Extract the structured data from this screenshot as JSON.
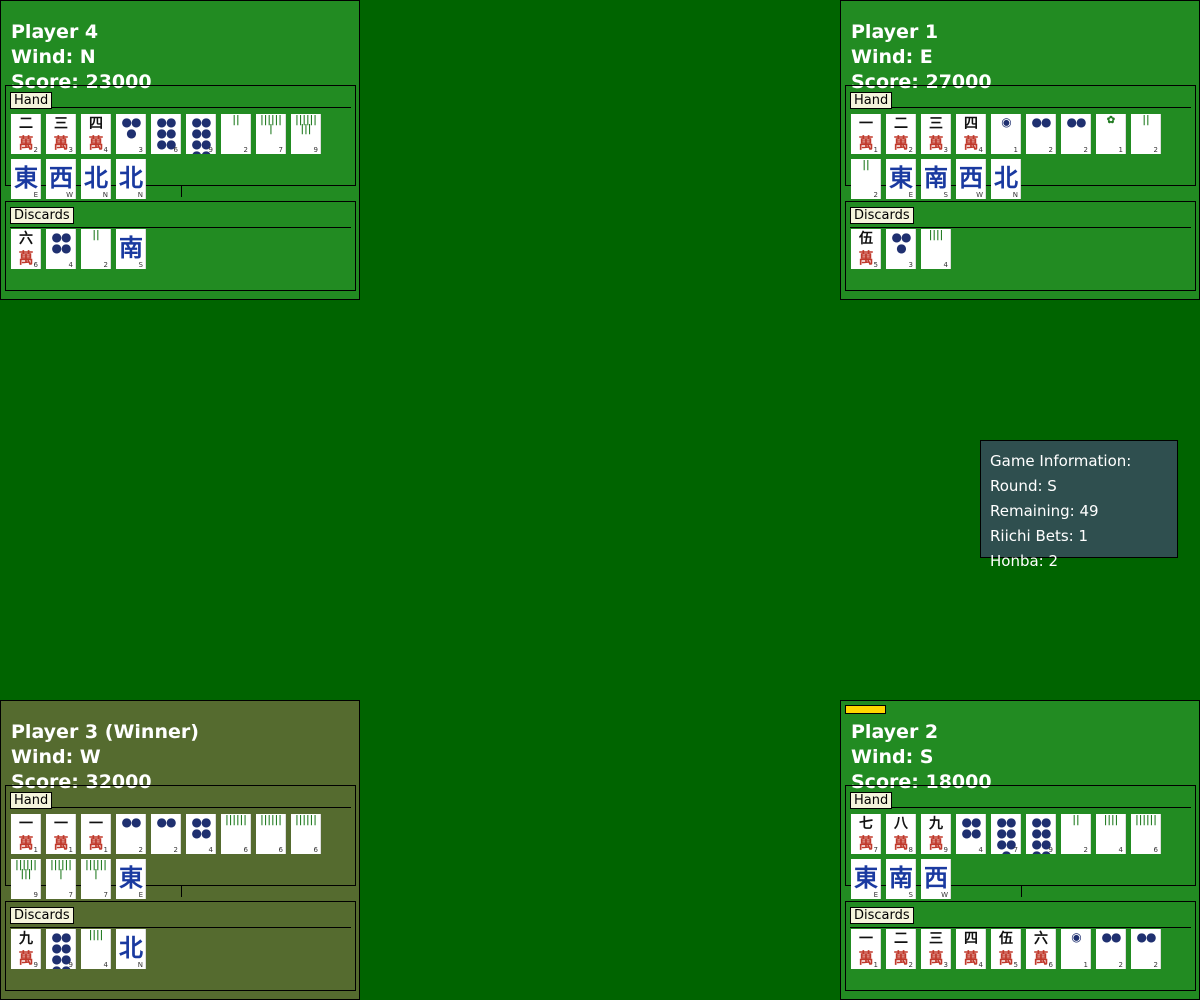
{
  "players": [
    {
      "key": "p4",
      "name": "Player 4",
      "wind": "Wind: N",
      "score": "Score: 23000",
      "winner": false,
      "hand_label": "Hand",
      "discards_label": "Discards",
      "hand": [
        {
          "suit": "man",
          "top": "二",
          "bottom": "萬",
          "corner": "2"
        },
        {
          "suit": "man",
          "top": "三",
          "bottom": "萬",
          "corner": "3"
        },
        {
          "suit": "man",
          "top": "四",
          "bottom": "萬",
          "corner": "4"
        },
        {
          "suit": "pin",
          "top": "●●●",
          "corner": "3"
        },
        {
          "suit": "pin",
          "top": "●●●●●●",
          "corner": "6"
        },
        {
          "suit": "pin",
          "top": "●●●●●●●●●",
          "corner": "9"
        },
        {
          "suit": "sou",
          "top": "||",
          "corner": "2"
        },
        {
          "suit": "sou",
          "top": "|||||||",
          "corner": "7"
        },
        {
          "suit": "sou",
          "top": "|||||||||",
          "corner": "9"
        },
        {
          "suit": "honor",
          "top": "東",
          "corner": "E"
        },
        {
          "suit": "honor",
          "top": "西",
          "corner": "W"
        },
        {
          "suit": "honor",
          "top": "北",
          "corner": "N"
        },
        {
          "suit": "honor",
          "top": "北",
          "corner": "N"
        }
      ],
      "discards": [
        {
          "suit": "man",
          "top": "六",
          "bottom": "萬",
          "corner": "6"
        },
        {
          "suit": "pin",
          "top": "●●●●",
          "corner": "4"
        },
        {
          "suit": "sou",
          "top": "||",
          "corner": "2"
        },
        {
          "suit": "honor",
          "top": "南",
          "corner": "S"
        }
      ]
    },
    {
      "key": "p1",
      "name": "Player 1",
      "wind": "Wind: E",
      "score": "Score: 27000",
      "winner": false,
      "hand_label": "Hand",
      "discards_label": "Discards",
      "hand": [
        {
          "suit": "man",
          "top": "一",
          "bottom": "萬",
          "corner": "1"
        },
        {
          "suit": "man",
          "top": "二",
          "bottom": "萬",
          "corner": "2"
        },
        {
          "suit": "man",
          "top": "三",
          "bottom": "萬",
          "corner": "3"
        },
        {
          "suit": "man",
          "top": "四",
          "bottom": "萬",
          "corner": "4"
        },
        {
          "suit": "pin",
          "top": "◉",
          "corner": "1"
        },
        {
          "suit": "pin",
          "top": "●●",
          "corner": "2"
        },
        {
          "suit": "pin",
          "top": "●●",
          "corner": "2"
        },
        {
          "suit": "sou",
          "top": "✿",
          "corner": "1"
        },
        {
          "suit": "sou",
          "top": "||",
          "corner": "2"
        },
        {
          "suit": "sou",
          "top": "||",
          "corner": "2"
        },
        {
          "suit": "honor",
          "top": "東",
          "corner": "E"
        },
        {
          "suit": "honor",
          "top": "南",
          "corner": "S"
        },
        {
          "suit": "honor",
          "top": "西",
          "corner": "W"
        },
        {
          "suit": "honor",
          "top": "北",
          "corner": "N"
        }
      ],
      "discards": [
        {
          "suit": "man",
          "top": "伍",
          "bottom": "萬",
          "corner": "5"
        },
        {
          "suit": "pin",
          "top": "●●●",
          "corner": "3"
        },
        {
          "suit": "sou",
          "top": "||||",
          "corner": "4"
        }
      ]
    },
    {
      "key": "p3",
      "name": "Player 3 (Winner)",
      "wind": "Wind: W",
      "score": "Score: 32000",
      "winner": true,
      "hand_label": "Hand",
      "discards_label": "Discards",
      "hand": [
        {
          "suit": "man",
          "top": "一",
          "bottom": "萬",
          "corner": "1"
        },
        {
          "suit": "man",
          "top": "一",
          "bottom": "萬",
          "corner": "1"
        },
        {
          "suit": "man",
          "top": "一",
          "bottom": "萬",
          "corner": "1"
        },
        {
          "suit": "pin",
          "top": "●●",
          "corner": "2"
        },
        {
          "suit": "pin",
          "top": "●●",
          "corner": "2"
        },
        {
          "suit": "pin",
          "top": "●●●●",
          "corner": "4"
        },
        {
          "suit": "sou",
          "top": "||||||",
          "corner": "6"
        },
        {
          "suit": "sou",
          "top": "||||||",
          "corner": "6"
        },
        {
          "suit": "sou",
          "top": "||||||",
          "corner": "6"
        },
        {
          "suit": "sou",
          "top": "|||||||||",
          "corner": "9"
        },
        {
          "suit": "sou",
          "top": "|||||||",
          "corner": "7"
        },
        {
          "suit": "sou",
          "top": "|||||||",
          "corner": "7"
        },
        {
          "suit": "honor",
          "top": "東",
          "corner": "E"
        }
      ],
      "discards": [
        {
          "suit": "man",
          "top": "九",
          "bottom": "萬",
          "corner": "9"
        },
        {
          "suit": "pin",
          "top": "●●●●●●●●●",
          "corner": "9"
        },
        {
          "suit": "sou",
          "top": "||||",
          "corner": "4"
        },
        {
          "suit": "honor",
          "top": "北",
          "corner": "N"
        }
      ]
    },
    {
      "key": "p2",
      "name": "Player 2",
      "wind": "Wind: S",
      "score": "Score: 18000",
      "winner": false,
      "hand_label": "Hand",
      "discards_label": "Discards",
      "hand": [
        {
          "suit": "man",
          "top": "七",
          "bottom": "萬",
          "corner": "7"
        },
        {
          "suit": "man",
          "top": "八",
          "bottom": "萬",
          "corner": "8"
        },
        {
          "suit": "man",
          "top": "九",
          "bottom": "萬",
          "corner": "9"
        },
        {
          "suit": "pin",
          "top": "●●●●",
          "corner": "4"
        },
        {
          "suit": "pin",
          "top": "●●●●●●●",
          "corner": "7"
        },
        {
          "suit": "pin",
          "top": "●●●●●●●●●",
          "corner": "9"
        },
        {
          "suit": "sou",
          "top": "||",
          "corner": "2"
        },
        {
          "suit": "sou",
          "top": "||||",
          "corner": "4"
        },
        {
          "suit": "sou",
          "top": "||||||",
          "corner": "6"
        },
        {
          "suit": "honor",
          "top": "東",
          "corner": "E"
        },
        {
          "suit": "honor",
          "top": "南",
          "corner": "S"
        },
        {
          "suit": "honor",
          "top": "西",
          "corner": "W"
        }
      ],
      "discards": [
        {
          "suit": "man",
          "top": "一",
          "bottom": "萬",
          "corner": "1"
        },
        {
          "suit": "man",
          "top": "二",
          "bottom": "萬",
          "corner": "2"
        },
        {
          "suit": "man",
          "top": "三",
          "bottom": "萬",
          "corner": "3"
        },
        {
          "suit": "man",
          "top": "四",
          "bottom": "萬",
          "corner": "4"
        },
        {
          "suit": "man",
          "top": "伍",
          "bottom": "萬",
          "corner": "5"
        },
        {
          "suit": "man",
          "top": "六",
          "bottom": "萬",
          "corner": "6"
        },
        {
          "suit": "pin",
          "top": "◉",
          "corner": "1"
        },
        {
          "suit": "pin",
          "top": "●●",
          "corner": "2"
        },
        {
          "suit": "pin",
          "top": "●●",
          "corner": "2"
        }
      ]
    }
  ],
  "game_info": {
    "title": "Game Information:",
    "round": "Round: S",
    "remaining": "Remaining: 49",
    "riichi_bets": "Riichi Bets: 1",
    "honba": "Honba: 2"
  },
  "colors": {
    "table": "#006400",
    "panel": "#228b22",
    "winner_panel": "#556b2f",
    "info_panel": "#2f4f4f",
    "riichi_stick": "#ffd700"
  }
}
